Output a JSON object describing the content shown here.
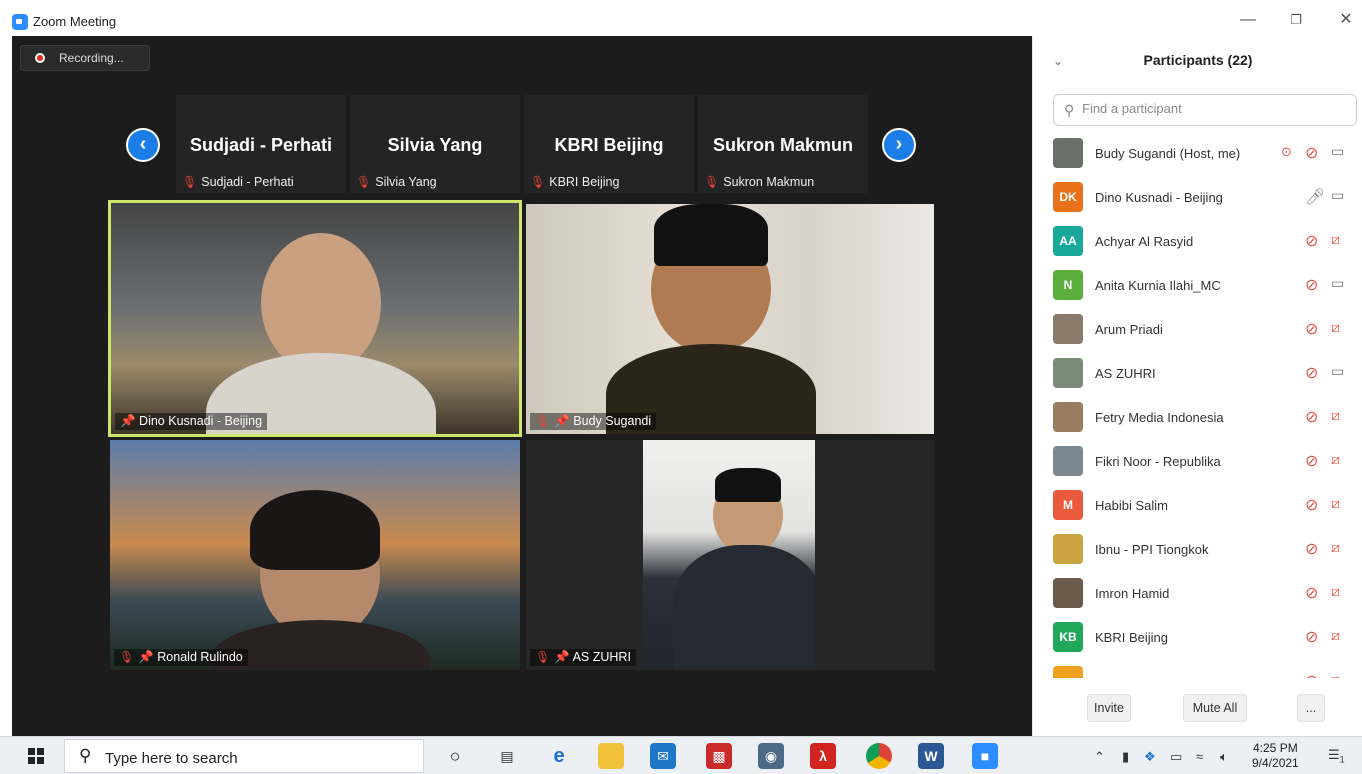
{
  "window": {
    "title": "Zoom Meeting"
  },
  "recording": {
    "label": "Recording..."
  },
  "strip": [
    {
      "name": "Sudjadi - Perhati",
      "label": "Sudjadi - Perhati"
    },
    {
      "name": "Silvia Yang",
      "label": "Silvia Yang"
    },
    {
      "name": "KBRI Beijing",
      "label": "KBRI Beijing"
    },
    {
      "name": "Sukron Makmun",
      "label": "Sukron Makmun"
    }
  ],
  "tiles": {
    "dino": "Dino Kusnadi - Beijing",
    "budy": "Budy Sugandi",
    "ronald": "Ronald Rulindo",
    "aszuhri": "AS ZUHRI"
  },
  "panel": {
    "title": "Participants (22)",
    "search_placeholder": "Find a participant",
    "invite": "Invite",
    "mute_all": "Mute All",
    "more": "..."
  },
  "participants": [
    {
      "name": "Budy Sugandi (Host, me)",
      "initials": "",
      "color": "#6b6f6a",
      "mic": "muted",
      "cam": "on",
      "recording": true
    },
    {
      "name": "Dino Kusnadi - Beijing",
      "initials": "DK",
      "color": "#e8711a",
      "mic": "on",
      "cam": "on",
      "recording": false
    },
    {
      "name": "Achyar Al Rasyid",
      "initials": "AA",
      "color": "#1aa89a",
      "mic": "muted",
      "cam": "off",
      "recording": false
    },
    {
      "name": "Anita Kurnia Ilahi_MC",
      "initials": "N",
      "color": "#5cae3c",
      "mic": "muted",
      "cam": "on",
      "recording": false
    },
    {
      "name": "Arum Priadi",
      "initials": "",
      "color": "#8a7a6a",
      "mic": "muted",
      "cam": "off",
      "recording": false
    },
    {
      "name": "AS ZUHRI",
      "initials": "",
      "color": "#7a8b78",
      "mic": "muted",
      "cam": "on",
      "recording": false
    },
    {
      "name": "Fetry Media Indonesia",
      "initials": "",
      "color": "#9a7d60",
      "mic": "muted",
      "cam": "off",
      "recording": false
    },
    {
      "name": "Fikri Noor - Republika",
      "initials": "",
      "color": "#7b8890",
      "mic": "muted",
      "cam": "off",
      "recording": false
    },
    {
      "name": "Habibi Salim",
      "initials": "M",
      "color": "#ea5a3c",
      "mic": "muted",
      "cam": "off",
      "recording": false
    },
    {
      "name": "Ibnu - PPI Tiongkok",
      "initials": "",
      "color": "#c9a341",
      "mic": "muted",
      "cam": "off",
      "recording": false
    },
    {
      "name": "Imron Hamid",
      "initials": "",
      "color": "#6a5a4a",
      "mic": "muted",
      "cam": "off",
      "recording": false
    },
    {
      "name": "KBRI Beijing",
      "initials": "KB",
      "color": "#21a85a",
      "mic": "muted",
      "cam": "off",
      "recording": false
    },
    {
      "name": "",
      "initials": "",
      "color": "#f0a020",
      "mic": "muted",
      "cam": "off",
      "recording": false
    }
  ],
  "taskbar": {
    "search_text": "Type here to search",
    "time": "4:25 PM",
    "date": "9/4/2021",
    "notifications": "1"
  }
}
